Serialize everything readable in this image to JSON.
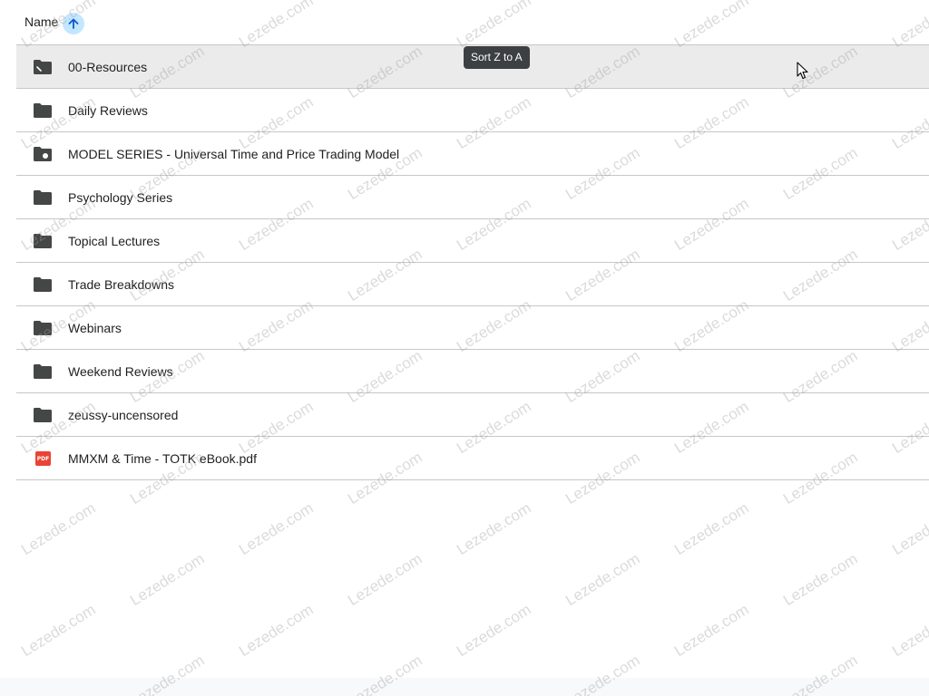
{
  "header": {
    "name_label": "Name"
  },
  "tooltip": {
    "text": "Sort Z to A"
  },
  "files": [
    {
      "name": "00-Resources",
      "type": "shared-folder"
    },
    {
      "name": "Daily Reviews",
      "type": "folder"
    },
    {
      "name": "MODEL SERIES - Universal Time and Price Trading Model",
      "type": "shared-folder"
    },
    {
      "name": "Psychology Series",
      "type": "folder"
    },
    {
      "name": "Topical Lectures",
      "type": "folder"
    },
    {
      "name": "Trade Breakdowns",
      "type": "folder"
    },
    {
      "name": "Webinars",
      "type": "folder"
    },
    {
      "name": "Weekend Reviews",
      "type": "folder"
    },
    {
      "name": "zeussy-uncensored",
      "type": "folder"
    },
    {
      "name": "MMXM & Time - TOTK eBook.pdf",
      "type": "pdf",
      "badge": "PDF"
    }
  ],
  "watermark": "Lezede.com",
  "colors": {
    "sort_button_bg": "#c2e7ff",
    "sort_arrow": "#0b57d0",
    "folder_icon": "#444746",
    "pdf_icon": "#ea4335",
    "hover_row": "#ebebeb",
    "tooltip_bg": "#3c4043"
  }
}
